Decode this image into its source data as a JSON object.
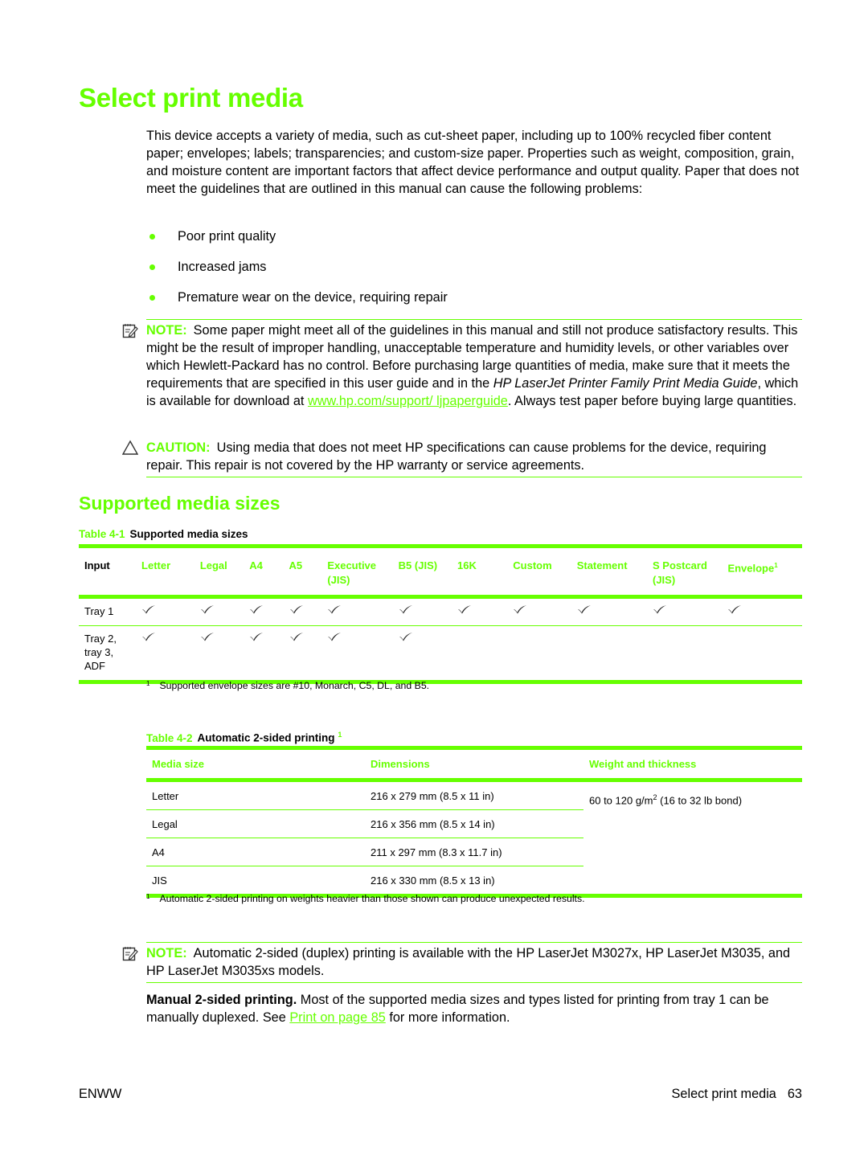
{
  "page": {
    "title": "Select print media",
    "intro": "This device accepts a variety of media, such as cut-sheet paper, including up to 100% recycled fiber content paper; envelopes; labels; transparencies; and custom-size paper. Properties such as weight, composition, grain, and moisture content are important factors that affect device performance and output quality. Paper that does not meet the guidelines that are outlined in this manual can cause the following problems:",
    "bullets": [
      "Poor print quality",
      "Increased jams",
      "Premature wear on the device, requiring repair"
    ],
    "note1": {
      "icon": "note-pencil-icon",
      "label": "NOTE:",
      "text_a": "Some paper might meet all of the guidelines in this manual and still not produce satisfactory results. This might be the result of improper handling, unacceptable temperature and humidity levels, or other variables over which Hewlett-Packard has no control. Before purchasing large quantities of media, make sure that it meets the requirements that are specified in this user guide and in the",
      "italic": "HP LaserJet Printer Family Print Media Guide",
      "text_b": ", which is available for download at ",
      "link": "www.hp.com/support/ ljpaperguide",
      "text_c": ". Always test paper before buying large quantities."
    },
    "caution": {
      "icon": "caution-triangle-icon",
      "label": "CAUTION:",
      "text": "Using media that does not meet HP specifications can cause problems for the device, requiring repair. This repair is not covered by the HP warranty or service agreements."
    },
    "section_title": "Supported media sizes",
    "table1": {
      "number": "Table 4-1",
      "caption": "Supported media sizes",
      "input_header": "Input",
      "columns": [
        {
          "label": "Letter",
          "sub": ""
        },
        {
          "label": "Legal",
          "sub": ""
        },
        {
          "label": "A4",
          "sub": ""
        },
        {
          "label": "A5",
          "sub": ""
        },
        {
          "label": "Executive",
          "sub": "(JIS)"
        },
        {
          "label": "B5 (JIS)",
          "sub": ""
        },
        {
          "label": "16K",
          "sub": ""
        },
        {
          "label": "Custom",
          "sub": ""
        },
        {
          "label": "Statement",
          "sub": ""
        },
        {
          "label": "S Postcard",
          "sub": "(JIS)"
        },
        {
          "label": "Envelope",
          "sub": "",
          "footnote": "1"
        }
      ],
      "rows": [
        {
          "input": "Tray 1",
          "supported": [
            true,
            true,
            true,
            true,
            true,
            true,
            true,
            true,
            true,
            true,
            true
          ]
        },
        {
          "input": "Tray 2, tray 3, ADF",
          "supported": [
            true,
            true,
            true,
            true,
            true,
            true,
            false,
            false,
            false,
            false,
            false
          ]
        }
      ],
      "footnote_mark": "1",
      "footnote": "Supported envelope sizes are #10, Monarch, C5, DL, and B5."
    },
    "table2": {
      "number": "Table 4-2",
      "caption": "Automatic 2-sided printing",
      "caption_footnote": "1",
      "headers": [
        "Media size",
        "Dimensions",
        "Weight and thickness"
      ],
      "rows": [
        {
          "media": "Letter",
          "dimensions": "216 x 279 mm (8.5 x 11 in)"
        },
        {
          "media": "Legal",
          "dimensions": "216 x 356 mm (8.5 x 14 in)"
        },
        {
          "media": "A4",
          "dimensions": "211 x 297 mm (8.3 x 11.7 in)"
        },
        {
          "media": "JIS",
          "dimensions": "216 x 330 mm (8.5 x 13 in)"
        }
      ],
      "weight_a": "60 to 120 g/m",
      "weight_sup": "2",
      "weight_b": " (16 to 32 lb bond)",
      "footnote_mark": "1",
      "footnote": "Automatic 2-sided printing on weights heavier than those shown can produce unexpected results."
    },
    "note2": {
      "icon": "note-pencil-icon",
      "label": "NOTE:",
      "text": "Automatic 2-sided (duplex) printing is available with the HP LaserJet M3027x, HP LaserJet M3035, and HP LaserJet M3035xs models."
    },
    "manual": {
      "bold": "Manual 2-sided printing.",
      "text_a": " Most of the supported media sizes and types listed for printing from tray 1 can be manually duplexed. See ",
      "link": "Print on page 85",
      "text_b": " for more information."
    },
    "footer": {
      "left": "ENWW",
      "section": "Select print media",
      "page_number": "63"
    }
  },
  "colors": {
    "accent": "#66ff00",
    "text": "#000000"
  }
}
